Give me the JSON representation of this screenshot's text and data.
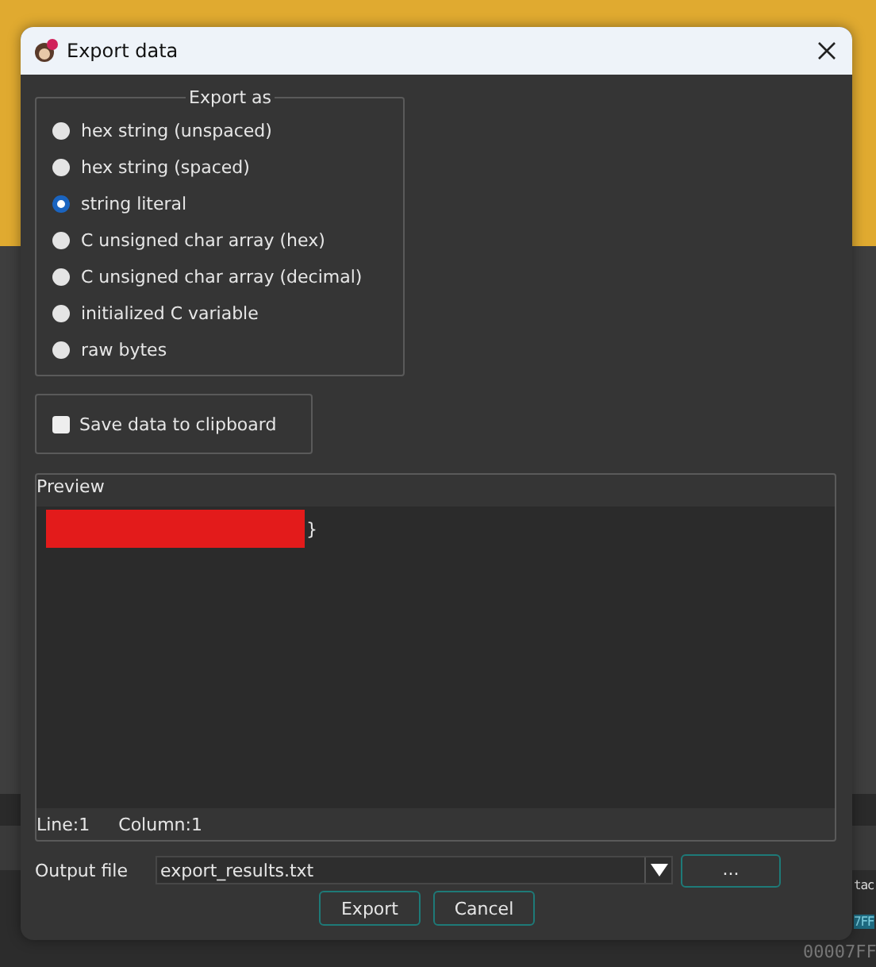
{
  "window": {
    "title": "Export data"
  },
  "export_as": {
    "title": "Export as",
    "options": [
      {
        "label": "hex string (unspaced)",
        "selected": false
      },
      {
        "label": "hex string (spaced)",
        "selected": false
      },
      {
        "label": "string literal",
        "selected": true
      },
      {
        "label": "C unsigned char array (hex)",
        "selected": false
      },
      {
        "label": "C unsigned char array (decimal)",
        "selected": false
      },
      {
        "label": "initialized C variable",
        "selected": false
      },
      {
        "label": "raw bytes",
        "selected": false
      }
    ]
  },
  "clipboard": {
    "label": "Save data to clipboard",
    "checked": false
  },
  "preview": {
    "title": "Preview",
    "redacted": true,
    "text_after": "}",
    "status": [
      "Line:1",
      "Column:1"
    ]
  },
  "output_file": {
    "label": "Output file",
    "value": "export_results.txt",
    "browse": "..."
  },
  "buttons": [
    "Export",
    "Cancel"
  ],
  "background_fragments": [
    "tac",
    "7FF",
    "00007FF"
  ]
}
